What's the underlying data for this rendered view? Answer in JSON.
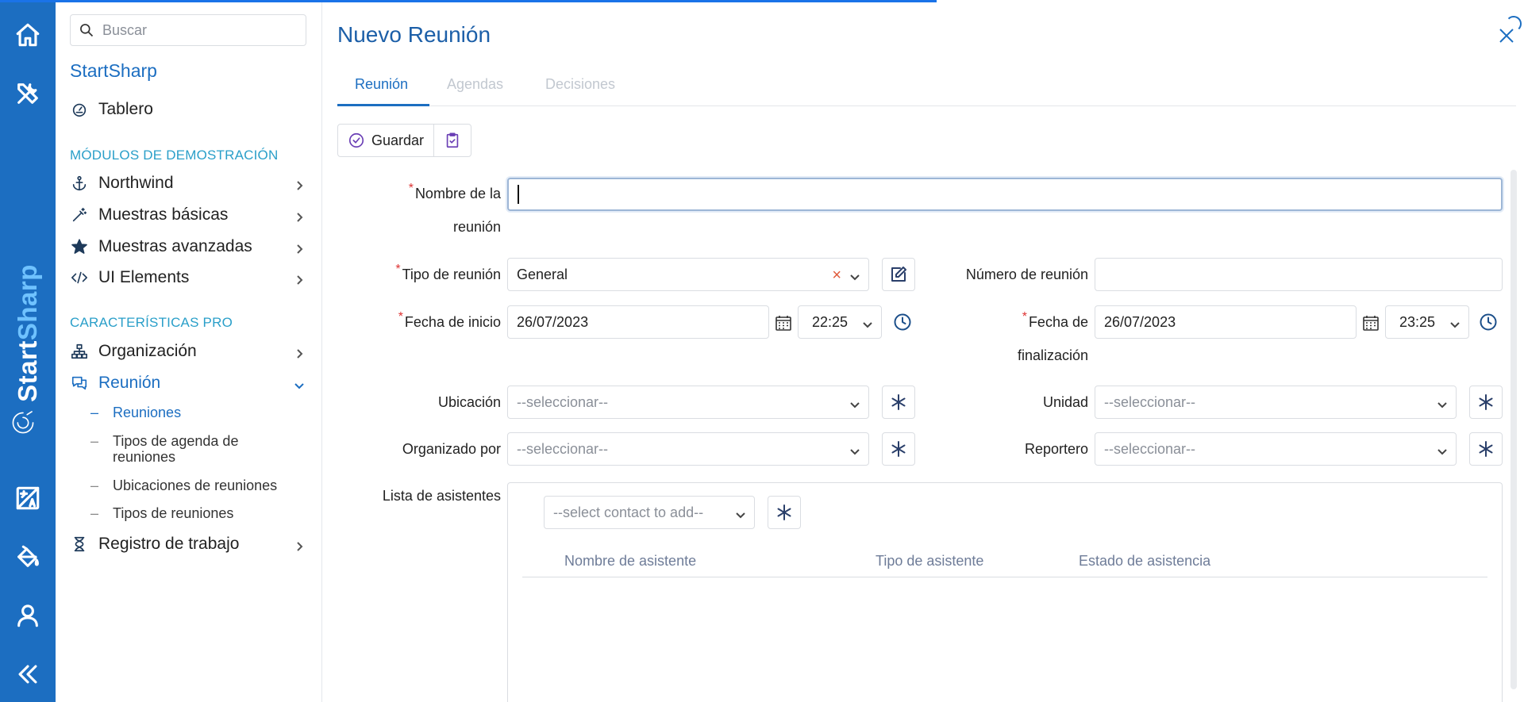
{
  "rail": {
    "icons": [
      "home-icon",
      "tools-icon",
      "translate-icon",
      "paint-bucket-icon",
      "user-icon",
      "collapse-icon"
    ],
    "brand_start": "Start",
    "brand_sharp": "Sharp"
  },
  "sidebar": {
    "search_placeholder": "Buscar",
    "app_title": "StartSharp",
    "dashboard": "Tablero",
    "section_demo": "MÓDULOS DE DEMOSTRACIÓN",
    "demo_items": [
      {
        "label": "Northwind",
        "icon": "anchor-icon"
      },
      {
        "label": "Muestras básicas",
        "icon": "wand-icon"
      },
      {
        "label": "Muestras avanzadas",
        "icon": "star-icon"
      },
      {
        "label": "UI Elements",
        "icon": "code-icon"
      }
    ],
    "section_pro": "CARACTERÍSTICAS PRO",
    "pro_items": [
      {
        "label": "Organización",
        "icon": "sitemap-icon"
      },
      {
        "label": "Reunión",
        "icon": "chat-icon"
      }
    ],
    "meeting_sub": [
      "Reuniones",
      "Tipos de agenda de reuniones",
      "Ubicaciones de reuniones",
      "Tipos de reuniones"
    ],
    "worklog": "Registro de trabajo"
  },
  "dialog": {
    "title": "Nuevo Reunión",
    "tabs": [
      "Reunión",
      "Agendas",
      "Decisiones"
    ],
    "save_label": "Guardar",
    "form": {
      "name_label_1": "Nombre de la",
      "name_label_2": "reunión",
      "name_value": "",
      "type_label": "Tipo de reunión",
      "type_value": "General",
      "number_label": "Número de reunión",
      "number_value": "",
      "start_label": "Fecha de inicio",
      "start_date": "26/07/2023",
      "start_time": "22:25",
      "end_label_1": "Fecha de",
      "end_label_2": "finalización",
      "end_date": "26/07/2023",
      "end_time": "23:25",
      "location_label": "Ubicación",
      "location_placeholder": "--seleccionar--",
      "unit_label": "Unidad",
      "unit_placeholder": "--seleccionar--",
      "organizer_label": "Organizado por",
      "organizer_placeholder": "--seleccionar--",
      "reporter_label": "Reportero",
      "reporter_placeholder": "--seleccionar--",
      "attendees_label": "Lista de asistentes",
      "contact_placeholder": "--select contact to add--",
      "grid_headers": [
        "Nombre de asistente",
        "Tipo de asistente",
        "Estado de asistencia"
      ]
    }
  },
  "colors": {
    "rail": "#1c6ec1",
    "accent": "#1c6ec1",
    "section": "#2a9fc9",
    "required": "#d33333"
  }
}
